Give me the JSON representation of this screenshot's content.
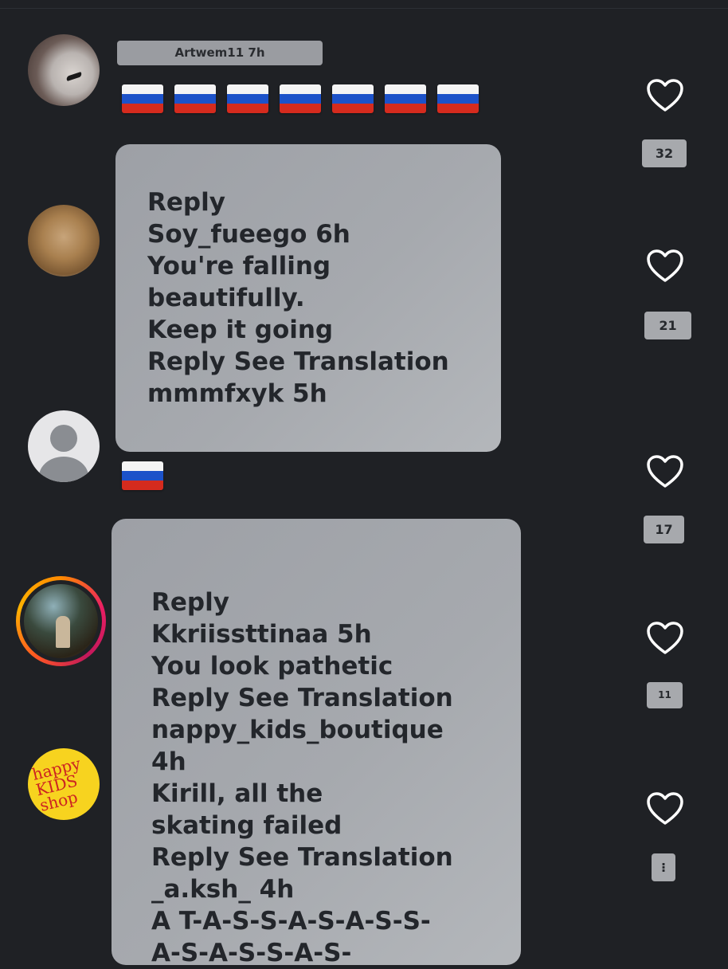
{
  "comments": [
    {
      "header": "Artwem11 7h",
      "flag_count": 7
    },
    {
      "flag_count": 1
    }
  ],
  "card1": {
    "lines": [
      "Reply",
      "Soy_fueego 6h",
      "You're falling",
      "beautifully.",
      "Keep it going",
      "Reply See Translation",
      "mmmfxyk 5h"
    ]
  },
  "card2": {
    "lines": [
      "Reply",
      "Kkriissttinaa 5h",
      "You look pathetic",
      "Reply See Translation",
      "nappy_kids_boutique",
      "4h",
      "Kirill, all the",
      "skating failed",
      "Reply See Translation",
      "_a.ksh_ 4h",
      "A T-A-S-S-A-S-A-S-S-",
      "A-S-A-S-S-A-S-"
    ]
  },
  "avatar5_text": "happy KIDS shop",
  "likes": [
    "32",
    "21",
    "17",
    "11",
    "⁝"
  ],
  "colors": {
    "background": "#1f2125",
    "card": "#a6a9ae",
    "text_dark": "#23262b",
    "heart": "#ffffff"
  }
}
